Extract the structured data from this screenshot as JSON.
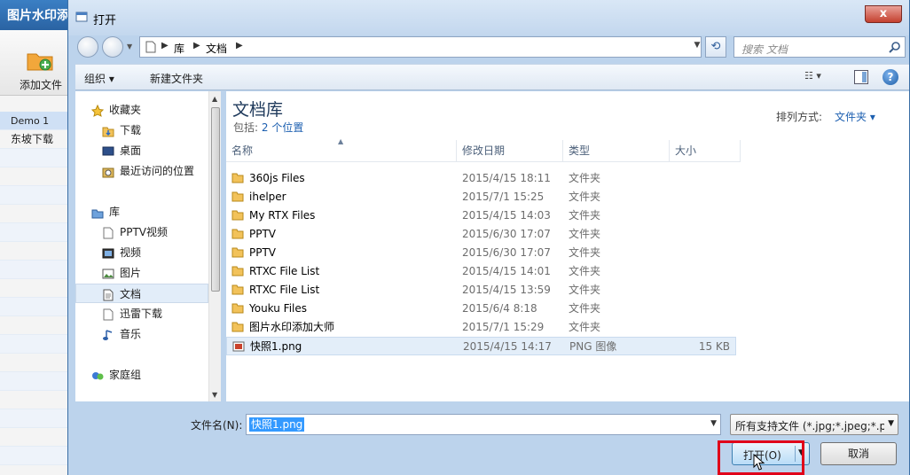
{
  "background_app": {
    "title": "图片水印添",
    "add_file_label": "添加文件",
    "list": [
      "Demo 1",
      "东坡下载"
    ]
  },
  "dialog": {
    "title": "打开",
    "close_label": "x",
    "breadcrumb": [
      "库",
      "文档"
    ],
    "search_placeholder": "搜索 文档",
    "toolbar": {
      "organize": "组织 ▾",
      "new_folder": "新建文件夹"
    },
    "nav": {
      "favorites": "收藏夹",
      "downloads": "下载",
      "desktop": "桌面",
      "recent": "最近访问的位置",
      "libraries": "库",
      "pptv_video": "PPTV视频",
      "videos": "视频",
      "pictures": "图片",
      "documents": "文档",
      "thunder": "迅雷下载",
      "music": "音乐",
      "homegroup": "家庭组"
    },
    "library": {
      "title": "文档库",
      "includes_label": "包括:",
      "includes_link": "2 个位置",
      "arrange_label": "排列方式:",
      "arrange_value": "文件夹 ▾"
    },
    "columns": [
      "名称",
      "修改日期",
      "类型",
      "大小"
    ],
    "files": [
      {
        "name": "360js Files",
        "date": "2015/4/15 18:11",
        "type": "文件夹",
        "size": ""
      },
      {
        "name": "ihelper",
        "date": "2015/7/1 15:25",
        "type": "文件夹",
        "size": ""
      },
      {
        "name": "My RTX Files",
        "date": "2015/4/15 14:03",
        "type": "文件夹",
        "size": ""
      },
      {
        "name": "PPTV",
        "date": "2015/6/30 17:07",
        "type": "文件夹",
        "size": ""
      },
      {
        "name": "PPTV",
        "date": "2015/6/30 17:07",
        "type": "文件夹",
        "size": ""
      },
      {
        "name": "RTXC File List",
        "date": "2015/4/15 14:01",
        "type": "文件夹",
        "size": ""
      },
      {
        "name": "RTXC File List",
        "date": "2015/4/15 13:59",
        "type": "文件夹",
        "size": ""
      },
      {
        "name": "Youku Files",
        "date": "2015/6/4 8:18",
        "type": "文件夹",
        "size": ""
      },
      {
        "name": "图片水印添加大师",
        "date": "2015/7/1 15:29",
        "type": "文件夹",
        "size": ""
      },
      {
        "name": "快照1.png",
        "date": "2015/4/15 14:17",
        "type": "PNG 图像",
        "size": "15 KB"
      }
    ],
    "filename_label": "文件名(N):",
    "filename_value": "快照1.png",
    "filter_value": "所有支持文件 (*.jpg;*.jpeg;*.p",
    "open_label": "打开(O)",
    "cancel_label": "取消"
  }
}
